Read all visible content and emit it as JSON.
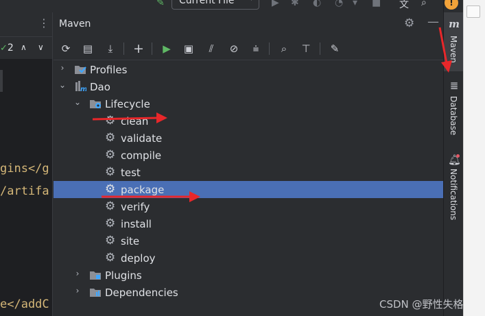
{
  "top_bar": {
    "run_config": "Current File",
    "update_badge": "!"
  },
  "editor": {
    "check_count": "2",
    "code_lines": [
      {
        "tag": "gins</g",
        "rest": ""
      },
      {
        "tag": "/artifa",
        "rest": ""
      },
      {
        "tag": "e</addC",
        "rest": ""
      }
    ]
  },
  "maven_panel": {
    "title": "Maven",
    "toolbar": [
      {
        "name": "reload-icon",
        "glyph": "⟳"
      },
      {
        "name": "generate-sources-icon",
        "glyph": "▤"
      },
      {
        "name": "download-icon",
        "glyph": "⤓"
      },
      {
        "name": "add-icon",
        "glyph": "+"
      },
      {
        "name": "run-icon",
        "glyph": "▶"
      },
      {
        "name": "execute-goal-icon",
        "glyph": "▣"
      },
      {
        "name": "toggle-offline-icon",
        "glyph": "⫽"
      },
      {
        "name": "skip-tests-icon",
        "glyph": "⊘"
      },
      {
        "name": "collapse-all-icon",
        "glyph": "⩧"
      },
      {
        "name": "analyze-icon",
        "glyph": "⌕"
      },
      {
        "name": "show-dependencies-icon",
        "glyph": "⊤"
      },
      {
        "name": "settings-wrench-icon",
        "glyph": "✎"
      }
    ],
    "tree": {
      "profiles": "Profiles",
      "project": "Dao",
      "lifecycle": "Lifecycle",
      "goals": [
        "clean",
        "validate",
        "compile",
        "test",
        "package",
        "verify",
        "install",
        "site",
        "deploy"
      ],
      "selected_goal": "package",
      "plugins": "Plugins",
      "dependencies": "Dependencies"
    }
  },
  "right_stripe": {
    "maven_label": "Maven",
    "database_label": "Database",
    "notifications_label": "Notifications"
  },
  "watermark": "CSDN @野性失格",
  "colors": {
    "panel_bg": "#2b2d30",
    "selection": "#4a6fb5",
    "annotation_arrow": "#e8272a",
    "run_green": "#5fb865"
  }
}
